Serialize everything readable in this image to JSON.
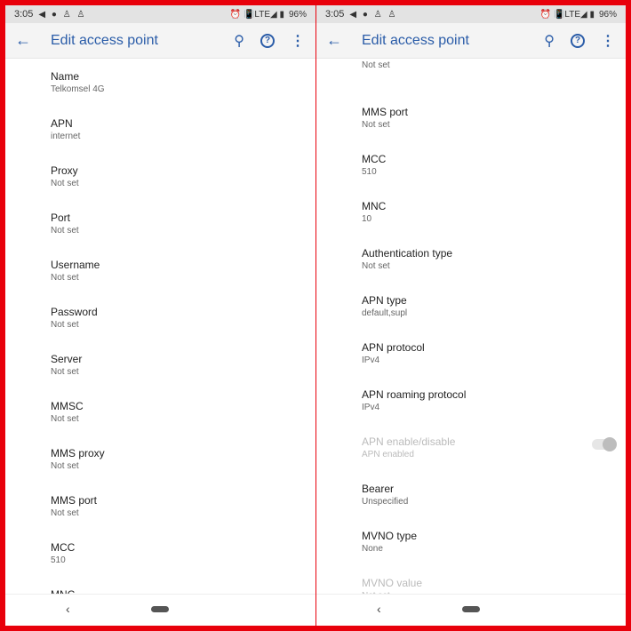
{
  "panels": [
    {
      "status": {
        "time": "3:05",
        "notif_icons": "◀ ● ♙ ♙",
        "right_icons": "⏰ 📳LTE◢ ▮",
        "battery": "96%"
      },
      "toolbar": {
        "title": "Edit access point"
      },
      "items": [
        {
          "title": "Name",
          "summary": "Telkomsel 4G"
        },
        {
          "title": "APN",
          "summary": "internet"
        },
        {
          "title": "Proxy",
          "summary": "Not set"
        },
        {
          "title": "Port",
          "summary": "Not set"
        },
        {
          "title": "Username",
          "summary": "Not set"
        },
        {
          "title": "Password",
          "summary": "Not set"
        },
        {
          "title": "Server",
          "summary": "Not set"
        },
        {
          "title": "MMSC",
          "summary": "Not set"
        },
        {
          "title": "MMS proxy",
          "summary": "Not set"
        },
        {
          "title": "MMS port",
          "summary": "Not set"
        },
        {
          "title": "MCC",
          "summary": "510"
        },
        {
          "title": "MNC",
          "summary": ""
        }
      ]
    },
    {
      "status": {
        "time": "3:05",
        "notif_icons": "◀ ● ♙ ♙",
        "right_icons": "⏰ 📳LTE◢ ▮",
        "battery": "96%"
      },
      "toolbar": {
        "title": "Edit access point"
      },
      "items": [
        {
          "title": "",
          "summary": "Not set"
        },
        {
          "title": "MMS port",
          "summary": "Not set"
        },
        {
          "title": "MCC",
          "summary": "510"
        },
        {
          "title": "MNC",
          "summary": "10"
        },
        {
          "title": "Authentication type",
          "summary": "Not set"
        },
        {
          "title": "APN type",
          "summary": "default,supl"
        },
        {
          "title": "APN protocol",
          "summary": "IPv4"
        },
        {
          "title": "APN roaming protocol",
          "summary": "IPv4"
        },
        {
          "title": "APN enable/disable",
          "summary": "APN enabled",
          "disabled": true,
          "toggle": true,
          "toggle_on": false
        },
        {
          "title": "Bearer",
          "summary": "Unspecified"
        },
        {
          "title": "MVNO type",
          "summary": "None"
        },
        {
          "title": "MVNO value",
          "summary": "Not set",
          "disabled": true
        }
      ]
    }
  ],
  "nav": {
    "back": "‹"
  },
  "colors": {
    "accent": "#2a5ca8",
    "frame": "#e8000b"
  }
}
